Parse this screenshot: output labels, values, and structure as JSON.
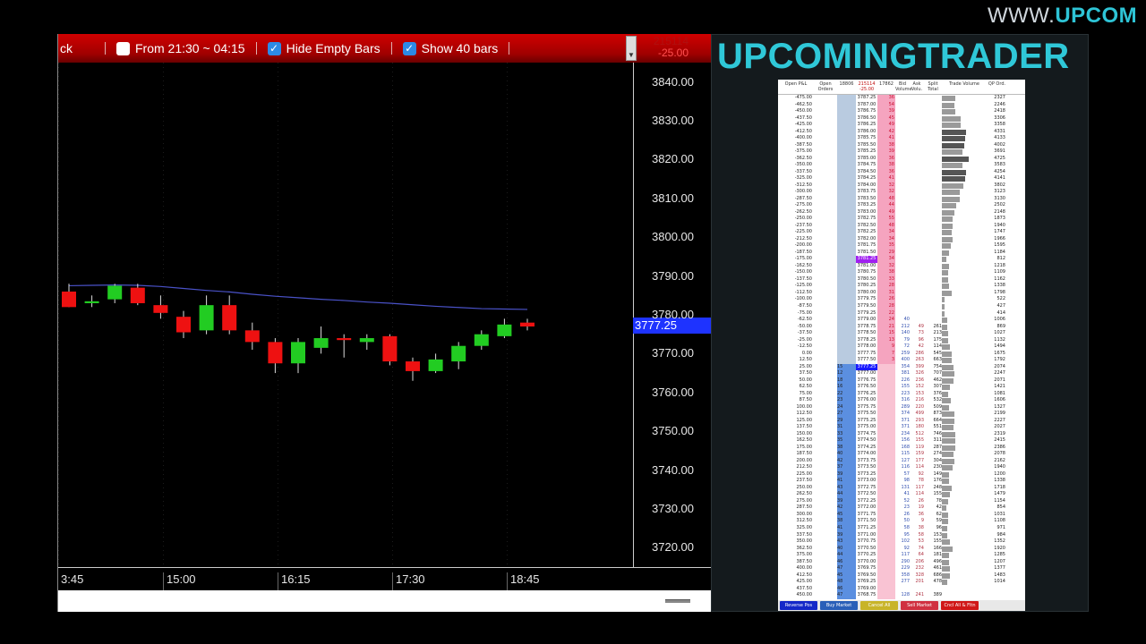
{
  "watermark": {
    "prefix": "WWW.",
    "brand": "UPCOM"
  },
  "toolbar": {
    "left_label": "ck",
    "from_label": "From  21:30 ~ 04:15",
    "from_checked": false,
    "hide_empty_label": "Hide Empty Bars",
    "hide_empty_checked": true,
    "show_label": "Show  40 bars",
    "show_checked": true,
    "change_top": "215114",
    "change_bottom": "-25.00"
  },
  "price_axis": {
    "ticks": [
      "3840.00",
      "3830.00",
      "3820.00",
      "3810.00",
      "3800.00",
      "3790.00",
      "3780.00",
      "3770.00",
      "3760.00",
      "3750.00",
      "3740.00",
      "3730.00",
      "3720.00"
    ],
    "current_price": "3777.25"
  },
  "time_axis": {
    "ticks": [
      "3:45",
      "15:00",
      "16:15",
      "17:30",
      "18:45"
    ]
  },
  "chart_data": {
    "type": "candlestick",
    "ylim": [
      3715,
      3845
    ],
    "x_ticks": [
      "3:45",
      "15:00",
      "16:15",
      "17:30",
      "18:45"
    ],
    "candles": [
      {
        "o": 3786.0,
        "h": 3788.0,
        "l": 3782.0,
        "c": 3782.0
      },
      {
        "o": 3783.0,
        "h": 3785.0,
        "l": 3782.0,
        "c": 3783.5
      },
      {
        "o": 3784.0,
        "h": 3788.0,
        "l": 3783.0,
        "c": 3787.5
      },
      {
        "o": 3787.0,
        "h": 3788.0,
        "l": 3782.5,
        "c": 3783.0
      },
      {
        "o": 3782.5,
        "h": 3785.0,
        "l": 3779.0,
        "c": 3780.5
      },
      {
        "o": 3779.5,
        "h": 3781.0,
        "l": 3774.0,
        "c": 3775.5
      },
      {
        "o": 3776.0,
        "h": 3785.0,
        "l": 3775.0,
        "c": 3782.5
      },
      {
        "o": 3782.5,
        "h": 3785.0,
        "l": 3775.0,
        "c": 3776.0
      },
      {
        "o": 3776.0,
        "h": 3778.0,
        "l": 3771.0,
        "c": 3773.0
      },
      {
        "o": 3773.0,
        "h": 3774.0,
        "l": 3765.0,
        "c": 3767.5
      },
      {
        "o": 3767.5,
        "h": 3774.0,
        "l": 3765.0,
        "c": 3773.0
      },
      {
        "o": 3771.5,
        "h": 3777.0,
        "l": 3770.0,
        "c": 3774.0
      },
      {
        "o": 3774.0,
        "h": 3775.0,
        "l": 3769.0,
        "c": 3773.5
      },
      {
        "o": 3773.0,
        "h": 3775.0,
        "l": 3771.0,
        "c": 3774.0
      },
      {
        "o": 3774.5,
        "h": 3775.0,
        "l": 3767.0,
        "c": 3768.0
      },
      {
        "o": 3768.0,
        "h": 3769.0,
        "l": 3763.0,
        "c": 3765.5
      },
      {
        "o": 3765.5,
        "h": 3770.0,
        "l": 3765.0,
        "c": 3768.5
      },
      {
        "o": 3768.0,
        "h": 3773.0,
        "l": 3766.0,
        "c": 3772.0
      },
      {
        "o": 3772.0,
        "h": 3776.0,
        "l": 3771.0,
        "c": 3775.0
      },
      {
        "o": 3774.5,
        "h": 3779.0,
        "l": 3774.0,
        "c": 3777.5
      },
      {
        "o": 3778.0,
        "h": 3779.0,
        "l": 3776.0,
        "c": 3777.0
      }
    ],
    "moving_average": [
      3787.5,
      3787.6,
      3787.7,
      3787.6,
      3787.3,
      3786.8,
      3786.3,
      3785.9,
      3785.3,
      3784.8,
      3784.4,
      3784.0,
      3783.7,
      3783.3,
      3783.0,
      3782.6,
      3782.2,
      3781.9,
      3781.6,
      3781.5,
      3781.4
    ],
    "colors": {
      "up": "#22cc22",
      "down": "#ee1111",
      "ma": "#4a52c8"
    }
  },
  "panel": {
    "title": "UPCOMINGTRADER"
  },
  "dom": {
    "headers": [
      "Open P&L",
      "Open Orders",
      "18806",
      "215114 -25.00",
      "17862",
      "Bid Volume",
      "Ask Volu.",
      "Split Total",
      "Trade Volume",
      "QP Ord."
    ],
    "rows": [
      [
        "-475.00",
        "",
        "",
        "3787.25",
        "36",
        "",
        "",
        "",
        "",
        "2327"
      ],
      [
        "-462.50",
        "",
        "",
        "3787.00",
        "54",
        "",
        "",
        "",
        "",
        "2246"
      ],
      [
        "-450.00",
        "",
        "",
        "3786.75",
        "39",
        "",
        "",
        "",
        "",
        "2418"
      ],
      [
        "-437.50",
        "",
        "",
        "3786.50",
        "45",
        "",
        "",
        "",
        "",
        "3306"
      ],
      [
        "-425.00",
        "",
        "",
        "3786.25",
        "49",
        "",
        "",
        "",
        "",
        "3358"
      ],
      [
        "-412.50",
        "",
        "",
        "3786.00",
        "42",
        "",
        "",
        "",
        "",
        "4331"
      ],
      [
        "-400.00",
        "",
        "",
        "3785.75",
        "41",
        "",
        "",
        "",
        "",
        "4133"
      ],
      [
        "-387.50",
        "",
        "",
        "3785.50",
        "38",
        "",
        "",
        "",
        "",
        "4002"
      ],
      [
        "-375.00",
        "",
        "",
        "3785.25",
        "39",
        "",
        "",
        "",
        "",
        "3691"
      ],
      [
        "-362.50",
        "",
        "",
        "3785.00",
        "36",
        "",
        "",
        "",
        "",
        "4725"
      ],
      [
        "-350.00",
        "",
        "",
        "3784.75",
        "38",
        "",
        "",
        "",
        "",
        "3583"
      ],
      [
        "-337.50",
        "",
        "",
        "3784.50",
        "36",
        "",
        "",
        "",
        "",
        "4254"
      ],
      [
        "-325.00",
        "",
        "",
        "3784.25",
        "41",
        "",
        "",
        "",
        "",
        "4141"
      ],
      [
        "-312.50",
        "",
        "",
        "3784.00",
        "32",
        "",
        "",
        "",
        "",
        "3802"
      ],
      [
        "-300.00",
        "",
        "",
        "3783.75",
        "32",
        "",
        "",
        "",
        "",
        "3123"
      ],
      [
        "-287.50",
        "",
        "",
        "3783.50",
        "48",
        "",
        "",
        "",
        "",
        "3130"
      ],
      [
        "-275.00",
        "",
        "",
        "3783.25",
        "44",
        "",
        "",
        "",
        "",
        "2502"
      ],
      [
        "-262.50",
        "",
        "",
        "3783.00",
        "49",
        "",
        "",
        "",
        "",
        "2148"
      ],
      [
        "-250.00",
        "",
        "",
        "3782.75",
        "55",
        "",
        "",
        "",
        "",
        "1873"
      ],
      [
        "-237.50",
        "",
        "",
        "3782.50",
        "48",
        "",
        "",
        "",
        "",
        "1940"
      ],
      [
        "-225.00",
        "",
        "",
        "3782.25",
        "34",
        "",
        "",
        "",
        "",
        "1747"
      ],
      [
        "-212.50",
        "",
        "",
        "3782.00",
        "34",
        "",
        "",
        "",
        "",
        "1966"
      ],
      [
        "-200.00",
        "",
        "",
        "3781.75",
        "35",
        "",
        "",
        "",
        "",
        "1595"
      ],
      [
        "-187.50",
        "",
        "",
        "3781.50",
        "29",
        "",
        "",
        "",
        "",
        "1184"
      ],
      [
        "-175.00",
        "",
        "",
        "3781.25",
        "34",
        "",
        "",
        "",
        "",
        "812"
      ],
      [
        "-162.50",
        "",
        "",
        "3781.00",
        "32",
        "",
        "",
        "",
        "",
        "1218"
      ],
      [
        "-150.00",
        "",
        "",
        "3780.75",
        "38",
        "",
        "",
        "",
        "",
        "1109"
      ],
      [
        "-137.50",
        "",
        "",
        "3780.50",
        "33",
        "",
        "",
        "",
        "",
        "1162"
      ],
      [
        "-125.00",
        "",
        "",
        "3780.25",
        "28",
        "",
        "",
        "",
        "",
        "1338"
      ],
      [
        "-112.50",
        "",
        "",
        "3780.00",
        "31",
        "",
        "",
        "",
        "",
        "1798"
      ],
      [
        "-100.00",
        "",
        "",
        "3779.75",
        "26",
        "",
        "",
        "",
        "",
        "522"
      ],
      [
        "-87.50",
        "",
        "",
        "3779.50",
        "28",
        "",
        "",
        "",
        "",
        "427"
      ],
      [
        "-75.00",
        "",
        "",
        "3779.25",
        "22",
        "",
        "",
        "",
        "",
        "414"
      ],
      [
        "-62.50",
        "",
        "",
        "3779.00",
        "24",
        "40",
        "",
        "",
        "",
        "1006"
      ],
      [
        "-50.00",
        "",
        "",
        "3778.75",
        "21",
        "212",
        "49",
        "261",
        "",
        "869"
      ],
      [
        "-37.50",
        "",
        "",
        "3778.50",
        "15",
        "140",
        "73",
        "213",
        "",
        "1027"
      ],
      [
        "-25.00",
        "",
        "",
        "3778.25",
        "13",
        "79",
        "96",
        "175",
        "",
        "1132"
      ],
      [
        "-12.50",
        "",
        "",
        "3778.00",
        "9",
        "72",
        "42",
        "114",
        "",
        "1494"
      ],
      [
        "0.00",
        "",
        "",
        "3777.75",
        "7",
        "259",
        "286",
        "545",
        "",
        "1675"
      ],
      [
        "12.50",
        "",
        "",
        "3777.50",
        "3",
        "400",
        "263",
        "663",
        "",
        "1792"
      ],
      [
        "25.00",
        "",
        "15",
        "3777.25",
        "",
        "354",
        "399",
        "754",
        "",
        "2074"
      ],
      [
        "37.50",
        "",
        "12",
        "3777.00",
        "",
        "381",
        "326",
        "707",
        "",
        "2247"
      ],
      [
        "50.00",
        "",
        "18",
        "3776.75",
        "",
        "226",
        "236",
        "462",
        "",
        "2071"
      ],
      [
        "62.50",
        "",
        "16",
        "3776.50",
        "",
        "155",
        "152",
        "307",
        "",
        "1421"
      ],
      [
        "75.00",
        "",
        "22",
        "3776.25",
        "",
        "223",
        "153",
        "376",
        "",
        "1081"
      ],
      [
        "87.50",
        "",
        "23",
        "3776.00",
        "",
        "316",
        "216",
        "532",
        "",
        "1606"
      ],
      [
        "100.00",
        "",
        "24",
        "3775.75",
        "",
        "289",
        "220",
        "509",
        "",
        "1327"
      ],
      [
        "112.50",
        "",
        "27",
        "3775.50",
        "",
        "374",
        "499",
        "873",
        "",
        "2199"
      ],
      [
        "125.00",
        "",
        "29",
        "3775.25",
        "",
        "371",
        "293",
        "664",
        "",
        "2227"
      ],
      [
        "137.50",
        "",
        "31",
        "3775.00",
        "",
        "371",
        "180",
        "551",
        "",
        "2027"
      ],
      [
        "150.00",
        "",
        "33",
        "3774.75",
        "",
        "234",
        "512",
        "746",
        "",
        "2319"
      ],
      [
        "162.50",
        "",
        "35",
        "3774.50",
        "",
        "156",
        "155",
        "311",
        "",
        "2415"
      ],
      [
        "175.00",
        "",
        "38",
        "3774.25",
        "",
        "168",
        "119",
        "287",
        "",
        "2386"
      ],
      [
        "187.50",
        "",
        "40",
        "3774.00",
        "",
        "115",
        "159",
        "274",
        "",
        "2078"
      ],
      [
        "200.00",
        "",
        "42",
        "3773.75",
        "",
        "127",
        "177",
        "304",
        "",
        "2162"
      ],
      [
        "212.50",
        "",
        "37",
        "3773.50",
        "",
        "116",
        "114",
        "230",
        "",
        "1940"
      ],
      [
        "225.00",
        "",
        "39",
        "3773.25",
        "",
        "57",
        "92",
        "149",
        "",
        "1200"
      ],
      [
        "237.50",
        "",
        "41",
        "3773.00",
        "",
        "98",
        "78",
        "176",
        "",
        "1338"
      ],
      [
        "250.00",
        "",
        "43",
        "3772.75",
        "",
        "131",
        "117",
        "248",
        "",
        "1718"
      ],
      [
        "262.50",
        "",
        "44",
        "3772.50",
        "",
        "41",
        "114",
        "155",
        "",
        "1479"
      ],
      [
        "275.00",
        "",
        "39",
        "3772.25",
        "",
        "52",
        "26",
        "78",
        "",
        "1154"
      ],
      [
        "287.50",
        "",
        "42",
        "3772.00",
        "",
        "23",
        "19",
        "42",
        "",
        "854"
      ],
      [
        "300.00",
        "",
        "45",
        "3771.75",
        "",
        "26",
        "36",
        "62",
        "",
        "1031"
      ],
      [
        "312.50",
        "",
        "38",
        "3771.50",
        "",
        "50",
        "9",
        "59",
        "",
        "1108"
      ],
      [
        "325.00",
        "",
        "41",
        "3771.25",
        "",
        "58",
        "38",
        "96",
        "",
        "971"
      ],
      [
        "337.50",
        "",
        "39",
        "3771.00",
        "",
        "95",
        "58",
        "153",
        "",
        "984"
      ],
      [
        "350.00",
        "",
        "43",
        "3770.75",
        "",
        "102",
        "53",
        "155",
        "",
        "1352"
      ],
      [
        "362.50",
        "",
        "40",
        "3770.50",
        "",
        "92",
        "74",
        "166",
        "",
        "1920"
      ],
      [
        "375.00",
        "",
        "44",
        "3770.25",
        "",
        "117",
        "64",
        "181",
        "",
        "1285"
      ],
      [
        "387.50",
        "",
        "46",
        "3770.00",
        "",
        "290",
        "206",
        "496",
        "",
        "1207"
      ],
      [
        "400.00",
        "",
        "47",
        "3769.75",
        "",
        "229",
        "232",
        "461",
        "",
        "1377"
      ],
      [
        "412.50",
        "",
        "45",
        "3769.50",
        "",
        "358",
        "328",
        "686",
        "",
        "1483"
      ],
      [
        "425.00",
        "",
        "48",
        "3769.25",
        "",
        "277",
        "201",
        "478",
        "",
        "1014"
      ],
      [
        "437.50",
        "",
        "46",
        "3769.00",
        "",
        "",
        "",
        "",
        "",
        ""
      ],
      [
        "450.00",
        "",
        "47",
        "3768.75",
        "",
        "128",
        "241",
        "389",
        "",
        ""
      ]
    ],
    "buttons": [
      "Reverse Pos",
      "Buy Market",
      "Cancel All",
      "Sell Market",
      "Cncl All & Fltn"
    ],
    "button_colors": [
      "#1428c8",
      "#2a5fb8",
      "#c8b428",
      "#d03040",
      "#d01818"
    ]
  }
}
